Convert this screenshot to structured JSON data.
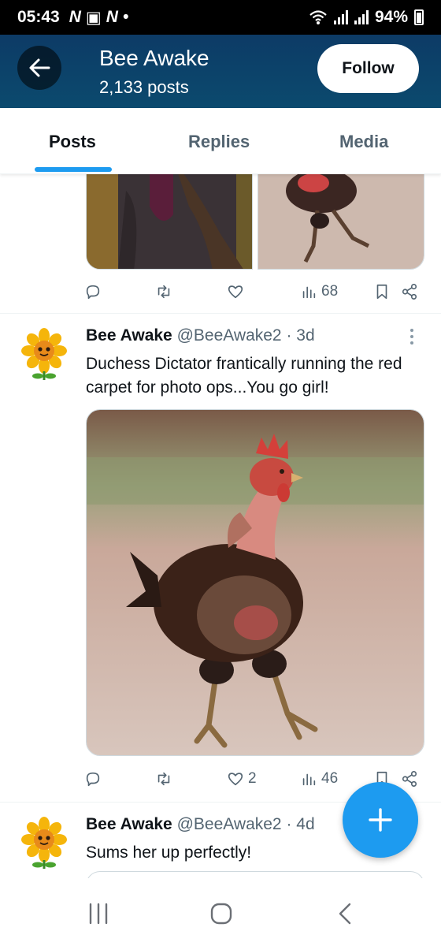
{
  "status_bar": {
    "time": "05:43",
    "notif_icons": [
      "N",
      "▣",
      "N",
      "•"
    ],
    "battery": "94%"
  },
  "header": {
    "title": "Bee Awake",
    "posts_count": "2,133 posts",
    "follow_label": "Follow"
  },
  "tabs": [
    {
      "label": "Posts",
      "active": true
    },
    {
      "label": "Replies",
      "active": false
    },
    {
      "label": "Media",
      "active": false
    }
  ],
  "posts": [
    {
      "views": "68"
    },
    {
      "name": "Bee Awake",
      "handle": "@BeeAwake2",
      "time": "· 3d",
      "text": "Duchess Dictator frantically running the red carpet for photo ops...You go girl!",
      "likes": "2",
      "views": "46"
    },
    {
      "name": "Bee Awake",
      "handle": "@BeeAwake2",
      "time": "· 4d",
      "text": "Sums her up perfectly!"
    }
  ],
  "icons": [
    "back-arrow-icon",
    "reply-icon",
    "retweet-icon",
    "like-icon",
    "views-icon",
    "bookmark-icon",
    "share-icon",
    "plus-icon",
    "sunflower-avatar-icon"
  ],
  "colors": {
    "accent": "#1d9bf0",
    "header_bg": "#0d3b66",
    "muted": "#536471"
  }
}
